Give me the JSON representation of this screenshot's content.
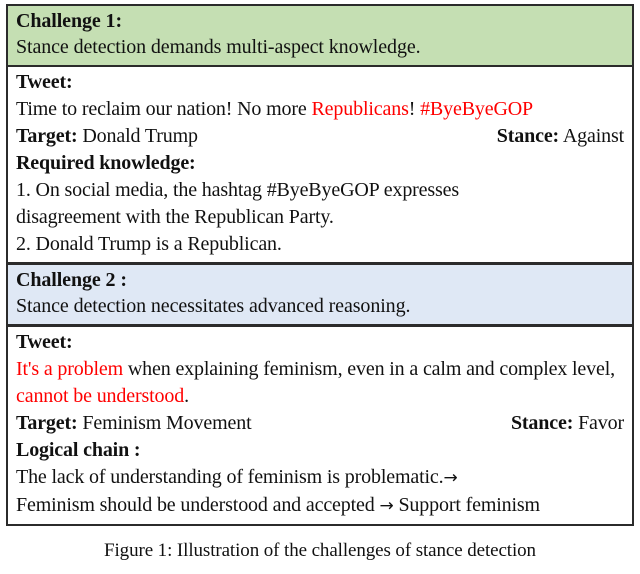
{
  "figure": {
    "caption": "Figure 1: Illustration of the challenges of stance detection",
    "colors": {
      "challenge1_band": "#c5dfb3",
      "challenge2_band": "#dfe8f5",
      "highlight": "#ff0000",
      "border": "#2b2b2b"
    }
  },
  "challenges": [
    {
      "title": "Challenge 1:",
      "subtitle": "Stance detection demands multi-aspect knowledge.",
      "tweet_label": "Tweet:",
      "tweet_parts": [
        {
          "text": "Time to reclaim our nation! No more ",
          "highlight": false
        },
        {
          "text": "Republicans",
          "highlight": true
        },
        {
          "text": "! ",
          "highlight": false
        },
        {
          "text": "#ByeByeGOP",
          "highlight": true
        }
      ],
      "target_label": "Target:",
      "target_value": "Donald Trump",
      "stance_label": "Stance:",
      "stance_value": "Against",
      "detail_label": "Required knowledge:",
      "detail_lines": [
        "1. On social media, the hashtag #ByeByeGOP expresses",
        "disagreement with the Republican Party.",
        "2. Donald Trump is a Republican."
      ]
    },
    {
      "title": "Challenge 2 :",
      "subtitle": "Stance detection necessitates advanced reasoning.",
      "tweet_label": "Tweet:",
      "tweet_parts": [
        {
          "text": "It's a problem",
          "highlight": true
        },
        {
          "text": " when explaining feminism, even in a calm and complex level, ",
          "highlight": false
        },
        {
          "text": "cannot be understood",
          "highlight": true
        },
        {
          "text": ".",
          "highlight": false
        }
      ],
      "target_label": "Target:",
      "target_value": "Feminism Movement",
      "stance_label": "Stance:",
      "stance_value": "Favor",
      "detail_label": "Logical chain :",
      "chain_line1": "The lack of understanding of feminism is problematic.",
      "chain_arrow1": "→",
      "chain_line2a": "Feminism should be understood and accepted",
      "chain_arrow2": "→",
      "chain_line2b": "Support feminism"
    }
  ]
}
